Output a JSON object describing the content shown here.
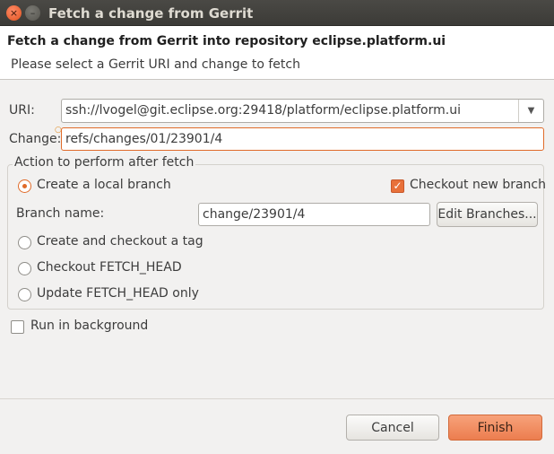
{
  "window": {
    "title": "Fetch a change from Gerrit",
    "close_glyph": "×",
    "minimize_glyph": "–"
  },
  "banner": {
    "title": "Fetch a change from Gerrit into repository eclipse.platform.ui",
    "message": "Please select a Gerrit URI and change to fetch"
  },
  "uri": {
    "label": "URI:",
    "value": "ssh://lvogel@git.eclipse.org:29418/platform/eclipse.platform.ui",
    "dropdown_icon": "chevron-down-icon"
  },
  "change": {
    "label": "Change:",
    "value": "refs/changes/01/23901/4",
    "warning_icon": "lightbulb-icon"
  },
  "action_group": {
    "title": "Action to perform after fetch",
    "options": [
      {
        "label": "Create a local branch",
        "selected": true
      },
      {
        "label": "Create and checkout a tag",
        "selected": false
      },
      {
        "label": "Checkout FETCH_HEAD",
        "selected": false
      },
      {
        "label": "Update FETCH_HEAD only",
        "selected": false
      }
    ],
    "checkout_new_branch": {
      "label": "Checkout new branch",
      "checked": true
    },
    "branch_name": {
      "label": "Branch name:",
      "value": "change/23901/4"
    },
    "edit_branches_label": "Edit Branches..."
  },
  "run_in_background": {
    "label": "Run in background",
    "checked": false
  },
  "footer": {
    "cancel_label": "Cancel",
    "finish_label": "Finish"
  },
  "colors": {
    "accent": "#e06b2a",
    "titlebar": "#3c3b37",
    "finish_button": "#ec7d4f"
  }
}
